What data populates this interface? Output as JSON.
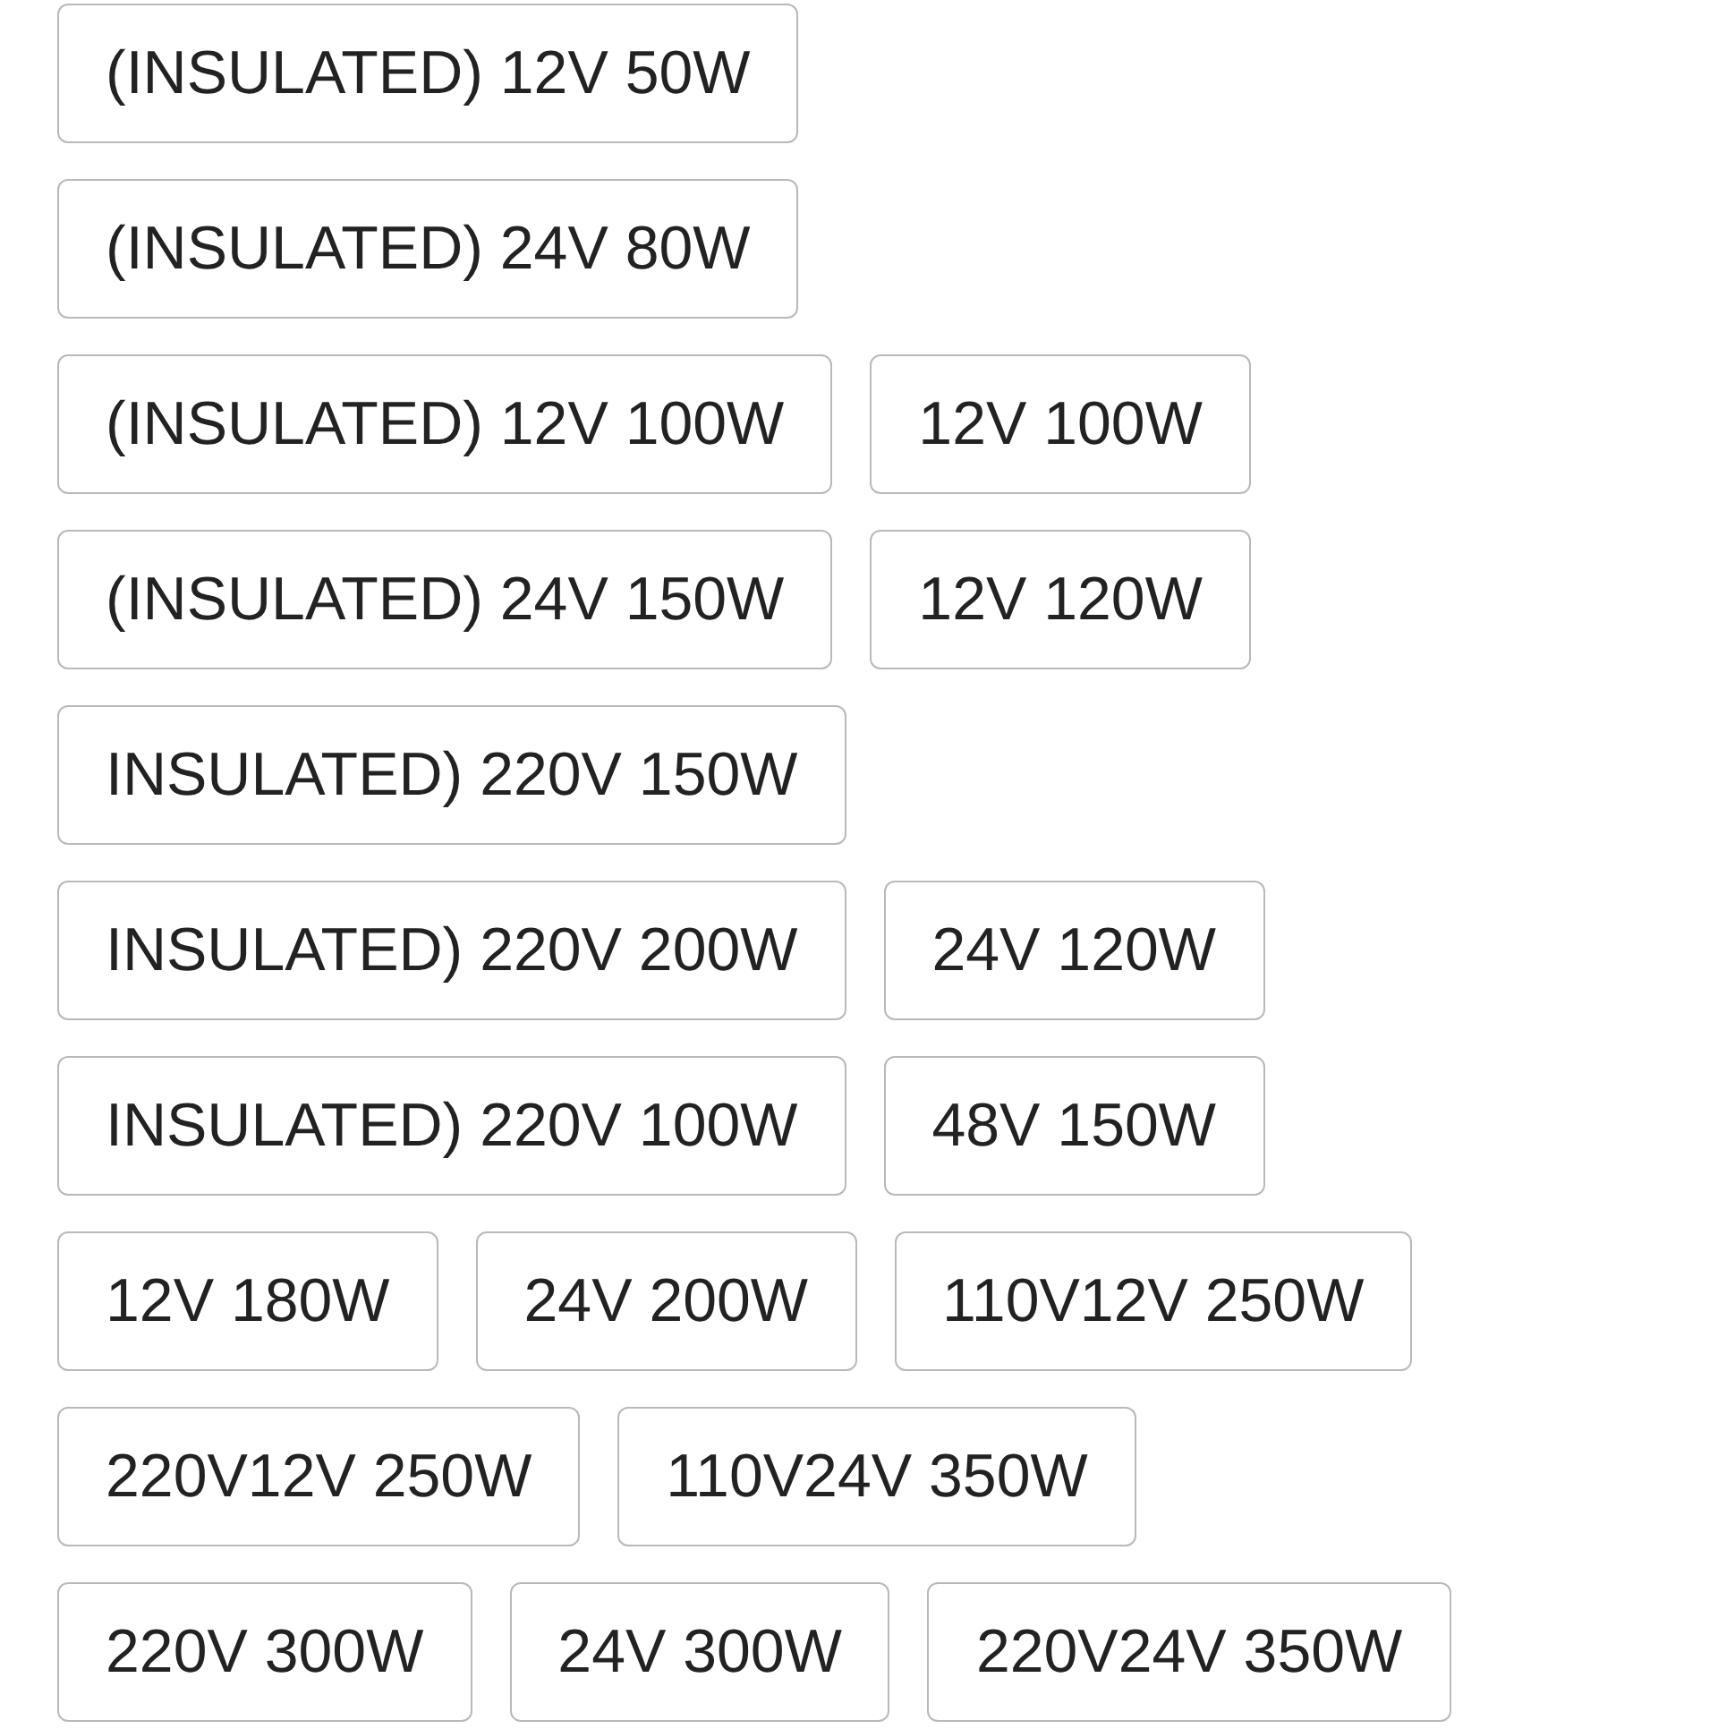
{
  "option_rows": [
    [
      "(INSULATED) 12V 50W"
    ],
    [
      "(INSULATED) 24V 80W"
    ],
    [
      "(INSULATED) 12V 100W",
      "12V 100W"
    ],
    [
      "(INSULATED) 24V 150W",
      "12V 120W"
    ],
    [
      "INSULATED) 220V 150W"
    ],
    [
      "INSULATED) 220V 200W",
      "24V 120W"
    ],
    [
      "INSULATED) 220V 100W",
      "48V 150W"
    ],
    [
      "12V 180W",
      "24V 200W",
      "110V12V 250W"
    ],
    [
      "220V12V 250W",
      "110V24V 350W"
    ],
    [
      "220V 300W",
      "24V 300W",
      "220V24V 350W"
    ]
  ]
}
